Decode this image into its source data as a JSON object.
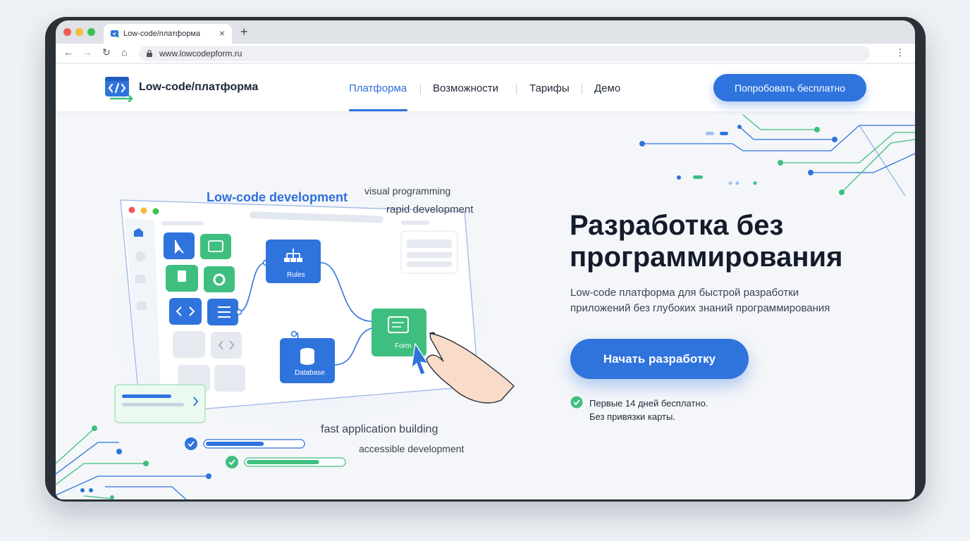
{
  "browser": {
    "tab_title": "Low-code/платформа",
    "tab_close": "×",
    "new_tab": "+",
    "url": "www.lowcodepform.ru",
    "back": "←",
    "forward": "→",
    "reload": "↻",
    "home": "⌂",
    "menu": "⋮"
  },
  "header": {
    "brand": "Low-code/платформа",
    "nav": [
      "Платформа",
      "Возможности",
      "Тарифы",
      "Демо"
    ],
    "cta": "Попробовать бесплатно"
  },
  "hero": {
    "title_line1": "Разработка без",
    "title_line2": "программирования",
    "subtitle_line1": "Low-code платформа для быстрой разработки",
    "subtitle_line2": "приложений без глубоких знаний программирования",
    "cta": "Начать разработку",
    "note_line1": "Первые 14 дней бесплатно.",
    "note_line2": "Без привязки карты."
  },
  "illustration": {
    "labels": {
      "low_code": "Low-code development",
      "visual": "visual programming",
      "rapid": "rapid development",
      "fast": "fast application building",
      "accessible": "accessible development"
    },
    "nodes": {
      "rules": "Rules",
      "database": "Database",
      "form": "Form"
    },
    "progress": [
      0.6,
      0.75
    ]
  },
  "colors": {
    "accent": "#2f73dd",
    "green": "#3fbf7f",
    "text": "#141c2c"
  }
}
